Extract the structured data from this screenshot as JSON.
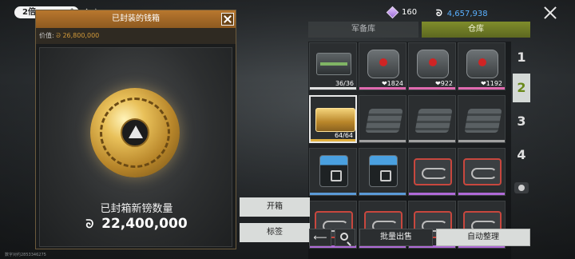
{
  "top_bar": {
    "pill_label": "2倍",
    "pill_icon": "✎",
    "tab_label": "仓库"
  },
  "currency": {
    "gems_icon": "diamond-icon",
    "gems": "160",
    "coin_glyph": "ᘐ",
    "coins": "4,657,938"
  },
  "tabs": {
    "armory": "军备库",
    "warehouse": "仓库"
  },
  "panel": {
    "title": "已封装的钱箱",
    "value_label": "价值: ",
    "value_coin_glyph": "ᘐ",
    "value_amount": "26,800,000",
    "caption": "已封箱新镑数量",
    "amount_coin_glyph": "ᘐ",
    "amount": "22,400,000"
  },
  "grid": {
    "items": [
      {
        "name": "ammo-crate-item",
        "art": "crate",
        "count": "36/36",
        "bar": "#e0e0e0"
      },
      {
        "name": "backpack-item",
        "art": "pack",
        "count": "❤1824",
        "bar": "#e06ab0"
      },
      {
        "name": "backpack-item",
        "art": "pack",
        "count": "❤922",
        "bar": "#e06ab0"
      },
      {
        "name": "backpack-item",
        "art": "pack",
        "count": "❤1192",
        "bar": "#e06ab0"
      },
      {
        "name": "gold-cash-case-item",
        "art": "gold",
        "count": "64/64",
        "bar": "#e0b040",
        "selected": true
      },
      {
        "name": "armor-plates-item",
        "art": "plates",
        "count": "",
        "bar": "#a0a0a0"
      },
      {
        "name": "armor-plates-item",
        "art": "plates",
        "count": "",
        "bar": "#a0a0a0"
      },
      {
        "name": "armor-plates-item",
        "art": "plates",
        "count": "",
        "bar": "#a0a0a0"
      },
      {
        "name": "supply-box-item",
        "art": "box",
        "count": "",
        "bar": "#5a9ad8"
      },
      {
        "name": "supply-box-item",
        "art": "box",
        "count": "",
        "bar": "#5a9ad8"
      },
      {
        "name": "tool-case-item",
        "art": "case",
        "count": "",
        "bar": "#b06ad8"
      },
      {
        "name": "tool-case-item",
        "art": "case",
        "count": "",
        "bar": "#b06ad8"
      },
      {
        "name": "tool-case-item",
        "art": "case",
        "count": "",
        "bar": "#b06ad8"
      },
      {
        "name": "tool-case-item",
        "art": "case",
        "count": "",
        "bar": "#b06ad8"
      },
      {
        "name": "tool-case-item",
        "art": "case",
        "count": "",
        "bar": "#b06ad8"
      },
      {
        "name": "tool-case-item",
        "art": "case",
        "count": "",
        "bar": "#b06ad8"
      }
    ]
  },
  "pages": {
    "p1": "1",
    "p2": "2",
    "p3": "3",
    "p4": "4",
    "extra_icon": "settings-icon"
  },
  "buttons": {
    "open": "开箱",
    "tag": "标签",
    "back": "⟵",
    "bulk_sell": "批量出售",
    "auto_sort": "自动整理"
  },
  "colors": {
    "accent_green": "#6a8a1a",
    "panel_header": "#b8772e",
    "gold": "#e9c15a"
  },
  "footer": {
    "uid": "数字对约2853346275"
  }
}
